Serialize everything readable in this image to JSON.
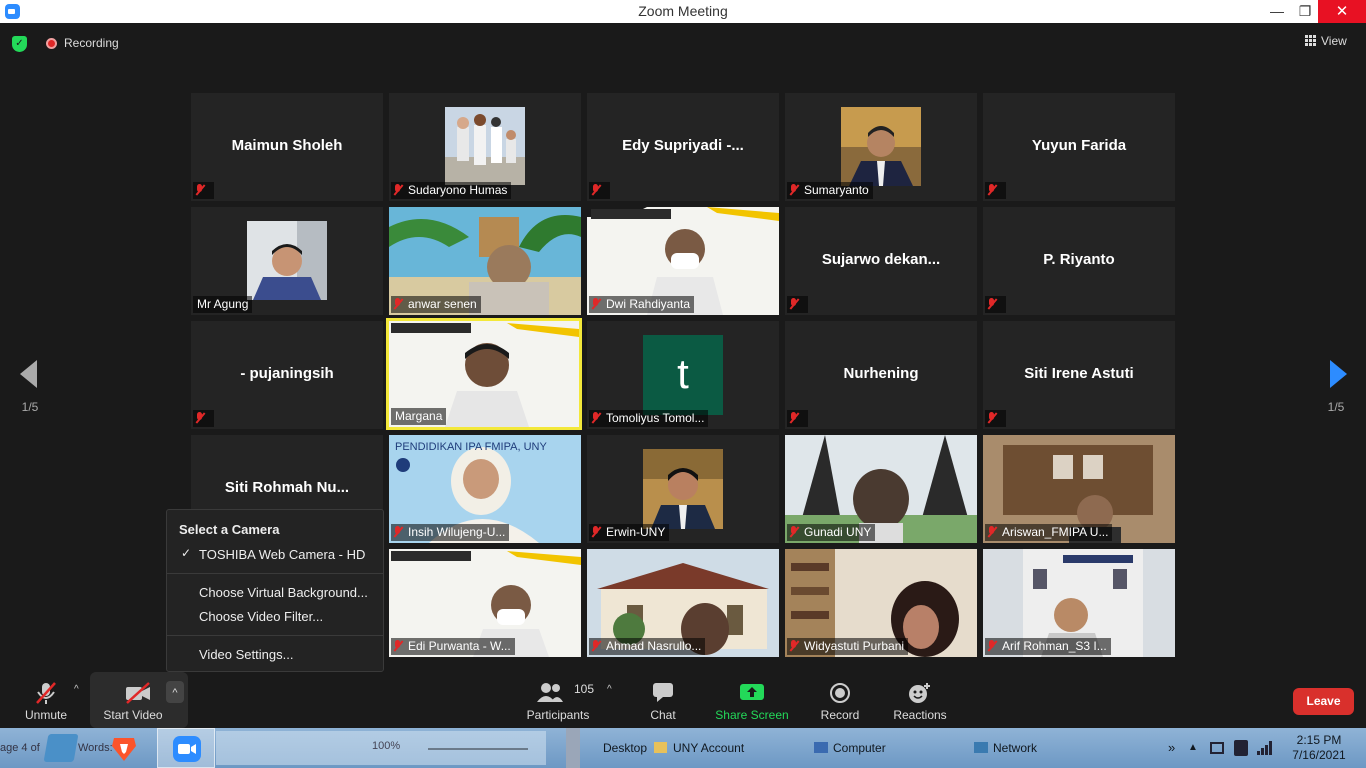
{
  "window": {
    "title": "Zoom Meeting",
    "minimize": "—",
    "maximize": "❐",
    "close": "✕"
  },
  "topbar": {
    "recording_label": "Recording",
    "view_label": "View"
  },
  "pager": {
    "left": "1/5",
    "right": "1/5"
  },
  "tiles": {
    "t0": {
      "name": "Maimun Sholeh"
    },
    "t1": {
      "label": "Sudaryono Humas"
    },
    "t2": {
      "name": "Edy  Supriyadi  -..."
    },
    "t3": {
      "label": "Sumaryanto"
    },
    "t4": {
      "name": "Yuyun Farida"
    },
    "t5": {
      "label": "Mr Agung"
    },
    "t6": {
      "label": "anwar senen"
    },
    "t7": {
      "label": "Dwi Rahdiyanta"
    },
    "t8": {
      "name": "Sujarwo  dekan..."
    },
    "t9": {
      "name": "P. Riyanto"
    },
    "t10": {
      "name": "- pujaningsih"
    },
    "t11": {
      "label": "Margana"
    },
    "t12": {
      "label": "Tomoliyus Tomol...",
      "avatar_letter": "t"
    },
    "t13": {
      "name": "Nurhening"
    },
    "t14": {
      "name": "Siti Irene Astuti"
    },
    "t15": {
      "name": "Siti  Rohmah  Nu..."
    },
    "t16": {
      "label": "Insih Wilujeng-U...",
      "banner": "PENDIDIKAN IPA FMIPA, UNY"
    },
    "t17": {
      "label": "Erwin-UNY"
    },
    "t18": {
      "label": "Gunadi UNY"
    },
    "t19": {
      "label": "Ariswan_FMIPA U..."
    },
    "t20": {
      "label": "Edi Purwanta - W..."
    },
    "t21": {
      "label": "Ahmad Nasrullo..."
    },
    "t22": {
      "label": "Widyastuti Purbani"
    },
    "t23": {
      "label": "Arif Rohman_S3 I..."
    }
  },
  "camera_menu": {
    "header": "Select a Camera",
    "camera": "TOSHIBA Web Camera - HD",
    "virtual_bg": "Choose Virtual Background...",
    "video_filter": "Choose Video Filter...",
    "video_settings": "Video Settings..."
  },
  "toolbar": {
    "unmute": "Unmute",
    "start_video": "Start Video",
    "participants_count": "105",
    "participants": "Participants",
    "chat": "Chat",
    "share_screen": "Share Screen",
    "record": "Record",
    "reactions": "Reactions",
    "leave": "Leave"
  },
  "taskbar": {
    "desktop": "Desktop",
    "uny_account": "UNY Account",
    "computer": "Computer",
    "network": "Network",
    "time": "2:15 PM",
    "date": "7/16/2021",
    "zoom_level": "100%",
    "words": "Words:",
    "page_fragment": "age 4 of"
  },
  "colors": {
    "accent": "#2d8cff",
    "share": "#23d959",
    "leave": "#d9302c",
    "mute": "#e02828",
    "active_speaker": "#f3e83a"
  }
}
